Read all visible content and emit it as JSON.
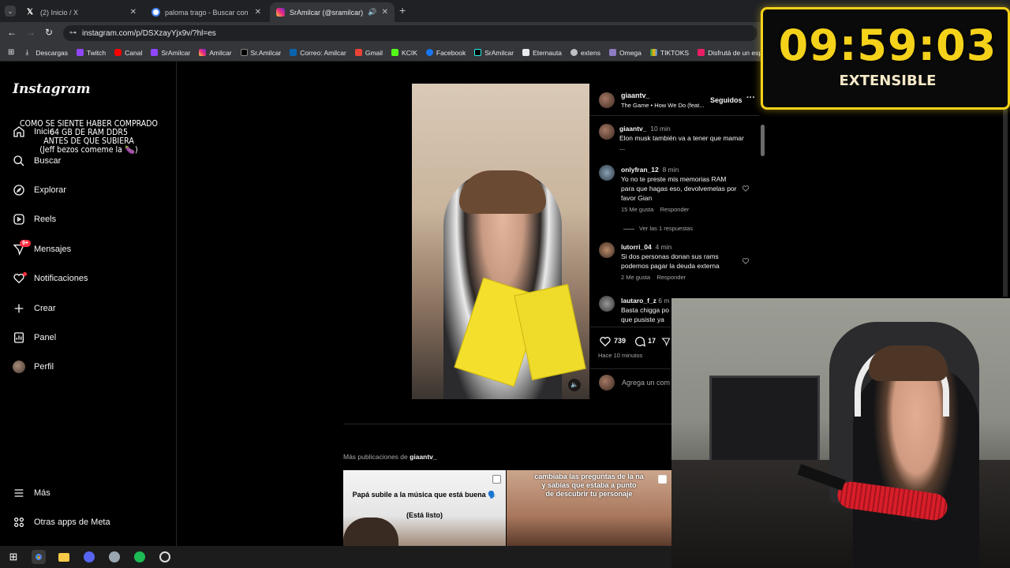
{
  "browser": {
    "tabs": [
      {
        "title": "(2) Inicio / X",
        "icon": "x-logo-icon"
      },
      {
        "title": "paloma trago - Buscar con Goo",
        "icon": "google-icon"
      },
      {
        "title": "SrAmilcar (@sramilcar) • Fo",
        "icon": "instagram-icon"
      }
    ],
    "url": "instagram.com/p/DSXzayYjx9v/?hl=es",
    "bookmarks": [
      "Descargas",
      "Twitch",
      "Canal",
      "SrAmilcar",
      "Amilcar",
      "Sr.Amilcar",
      "Correo: Amilcar",
      "Gmail",
      "KCIK",
      "Facebook",
      "SrAmilcar",
      "Eternauta",
      "extens",
      "Omega",
      "TIKTOKS",
      "Disfrutá de un espa..."
    ]
  },
  "instagram": {
    "logo": "Instagram",
    "nav": [
      {
        "label": "Inicio",
        "icon": "home-icon"
      },
      {
        "label": "Buscar",
        "icon": "search-icon"
      },
      {
        "label": "Explorar",
        "icon": "compass-icon"
      },
      {
        "label": "Reels",
        "icon": "reels-icon"
      },
      {
        "label": "Mensajes",
        "icon": "messages-icon",
        "badge": "9+"
      },
      {
        "label": "Notificaciones",
        "icon": "heart-icon"
      },
      {
        "label": "Crear",
        "icon": "plus-icon"
      },
      {
        "label": "Panel",
        "icon": "chart-icon"
      },
      {
        "label": "Perfil",
        "icon": "avatar"
      }
    ],
    "bottom_nav": [
      {
        "label": "Más",
        "icon": "menu-icon"
      },
      {
        "label": "Otras apps de Meta",
        "icon": "meta-apps-icon"
      }
    ],
    "post": {
      "video_caption": [
        "COMO SE SIENTE HABER COMPRADO",
        "64 GB DE RAM DDR5",
        "ANTES DE QUE SUBIERA",
        "(Jeff bezos comeme la 🍆)"
      ],
      "author": "giaantv_",
      "audio": "The Game • How We Do (feat...",
      "follow_label": "Seguidos",
      "comments": [
        {
          "user": "giaantv_",
          "time": "10 min",
          "text": "Elon musk también va a tener que mamar ..."
        },
        {
          "user": "onlyfran_12",
          "time": "8 min",
          "text": "Yo no te preste mis memorias RAM para que hagas eso, devolvemelas por favor Gian",
          "likes": "15 Me gusta",
          "reply": "Responder",
          "view_replies": "Ver las 1 respuestas"
        },
        {
          "user": "lutorri_04",
          "time": "4 min",
          "text": "Si dos personas donan sus rams podemos pagar la deuda externa",
          "likes": "2 Me gusta",
          "reply": "Responder"
        },
        {
          "user": "lautaro_f_z",
          "time": "6 m",
          "text": "Basta chigga po que pusiste ya"
        }
      ],
      "like_count": "739",
      "comment_count": "17",
      "time_ago": "Hace 10 minutos",
      "comment_placeholder": "Agrega un com"
    },
    "more_posts_label": "Más publicaciones de",
    "more_posts_user": "giaantv_",
    "thumbs": [
      {
        "text": [
          "Papá subile a la música que está buena 🗣️",
          "(Está listo)"
        ]
      },
      {
        "text": [
          "cambiaba las preguntas de la na",
          "y sabías que estaba a punto",
          "de descubrir tu personaje"
        ]
      }
    ]
  },
  "overlay": {
    "timer": "09:59:03",
    "timer_label": "EXTENSIBLE"
  },
  "colors": {
    "accent": "#f5d21a",
    "ig_bg": "#000000",
    "chrome": "#35363a"
  }
}
